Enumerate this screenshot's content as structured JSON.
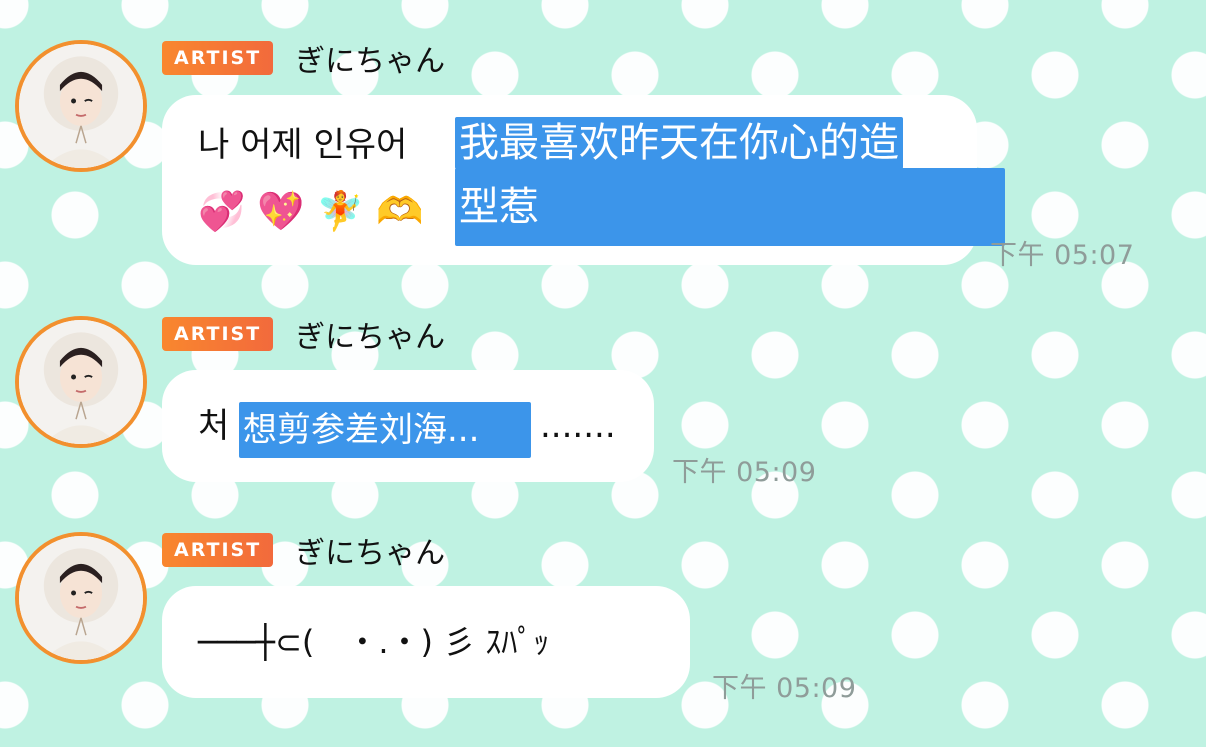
{
  "messages": [
    {
      "badge": "ARTIST",
      "sender": "ぎにちゃん",
      "text": "나 어제 인유어",
      "highlight_line1": "我最喜欢昨天在你心的造",
      "highlight_line2": "型惹",
      "emojis": "💞 💖 🧚 🫶",
      "time": "下午 05:07"
    },
    {
      "badge": "ARTIST",
      "sender": "ぎにちゃん",
      "text": "처",
      "highlight": "想剪参差刘海...",
      "trailing": ".......",
      "time": "下午 05:09"
    },
    {
      "badge": "ARTIST",
      "sender": "ぎにちゃん",
      "text": "───┼⊂(　・.・) 彡 ｽﾊﾟｯ",
      "time": "下午 05:09"
    }
  ],
  "colors": {
    "background": "#bff2e2",
    "badge": "#f9872e",
    "highlight": "#3c95ea",
    "timestamp": "#8f9c99",
    "avatar_ring": "#f2902e"
  }
}
